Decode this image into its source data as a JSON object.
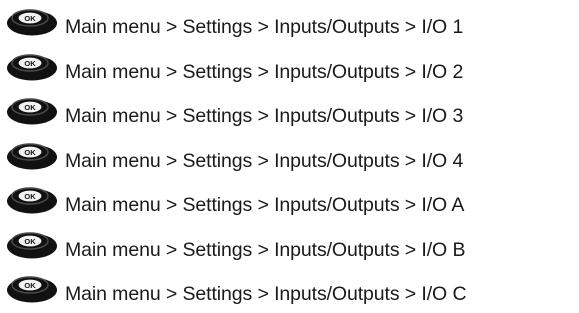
{
  "icon": {
    "name": "ok-button-icon",
    "label": "OK",
    "body_color": "#111111",
    "face_color": "#f2f2f2"
  },
  "rows": [
    {
      "path": "Main menu > Settings > Inputs/Outputs > I/O 1"
    },
    {
      "path": "Main menu > Settings > Inputs/Outputs > I/O 2"
    },
    {
      "path": "Main menu > Settings > Inputs/Outputs > I/O 3"
    },
    {
      "path": "Main menu > Settings > Inputs/Outputs > I/O 4"
    },
    {
      "path": "Main menu > Settings > Inputs/Outputs > I/O A"
    },
    {
      "path": "Main menu > Settings > Inputs/Outputs > I/O B"
    },
    {
      "path": "Main menu > Settings > Inputs/Outputs > I/O C"
    }
  ]
}
